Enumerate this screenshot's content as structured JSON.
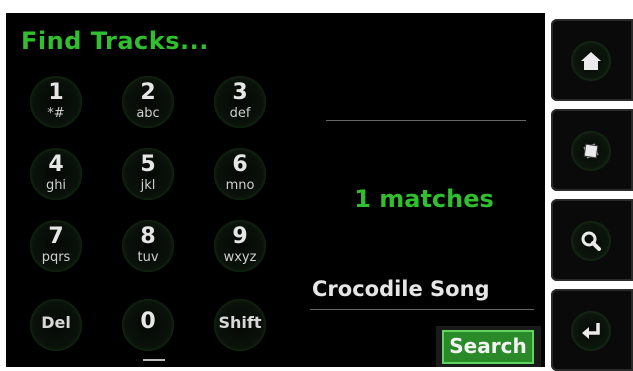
{
  "title": "Find Tracks...",
  "keypad": [
    {
      "digit": "1",
      "letters": "*#"
    },
    {
      "digit": "2",
      "letters": "abc"
    },
    {
      "digit": "3",
      "letters": "def"
    },
    {
      "digit": "4",
      "letters": "ghi"
    },
    {
      "digit": "5",
      "letters": "jkl"
    },
    {
      "digit": "6",
      "letters": "mno"
    },
    {
      "digit": "7",
      "letters": "pqrs"
    },
    {
      "digit": "8",
      "letters": "tuv"
    },
    {
      "digit": "9",
      "letters": "wxyz"
    }
  ],
  "bottom_keys": {
    "del": "Del",
    "zero": "0",
    "shift": "Shift"
  },
  "matches_text": "1  matches",
  "result_text": "Crocodile Song",
  "search_label": "Search",
  "colors": {
    "accent": "#2fbf2f",
    "background": "#000000",
    "button": "#2a8a2a"
  },
  "rail": [
    {
      "icon": "home-icon"
    },
    {
      "icon": "cards-icon"
    },
    {
      "icon": "magnifier-icon"
    },
    {
      "icon": "enter-arrow-icon"
    }
  ]
}
